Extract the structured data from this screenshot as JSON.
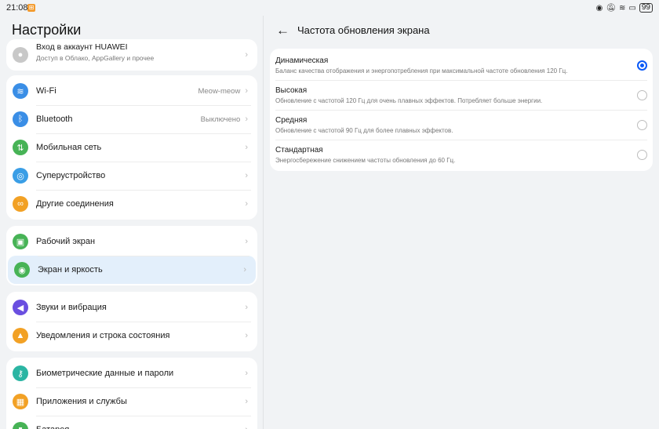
{
  "status_bar": {
    "time": "21:08",
    "battery": "99"
  },
  "left": {
    "title": "Настройки",
    "account": {
      "title": "Вход в аккаунт HUAWEI",
      "subtitle": "Доступ в Облако, AppGallery и прочее"
    },
    "groups": [
      [
        {
          "label": "Wi-Fi",
          "value": "Meow-meow",
          "icon": "wifi-icon",
          "color": "#3a8ee6"
        },
        {
          "label": "Bluetooth",
          "value": "Выключено",
          "icon": "bluetooth-icon",
          "color": "#3a8ee6"
        },
        {
          "label": "Мобильная сеть",
          "value": "",
          "icon": "mobile-network-icon",
          "color": "#47b356"
        },
        {
          "label": "Суперустройство",
          "value": "",
          "icon": "super-device-icon",
          "color": "#3a9ee6"
        },
        {
          "label": "Другие соединения",
          "value": "",
          "icon": "link-icon",
          "color": "#f2a125"
        }
      ],
      [
        {
          "label": "Рабочий экран",
          "value": "",
          "icon": "home-screen-icon",
          "color": "#47b356"
        },
        {
          "label": "Экран и яркость",
          "value": "",
          "icon": "eye-icon",
          "color": "#47b356",
          "active": true
        }
      ],
      [
        {
          "label": "Звуки и вибрация",
          "value": "",
          "icon": "speaker-icon",
          "color": "#6a4fe0"
        },
        {
          "label": "Уведомления и строка состояния",
          "value": "",
          "icon": "bell-icon",
          "color": "#f2a125"
        }
      ],
      [
        {
          "label": "Биометрические данные и пароли",
          "value": "",
          "icon": "key-icon",
          "color": "#2bb5a3"
        },
        {
          "label": "Приложения и службы",
          "value": "",
          "icon": "apps-icon",
          "color": "#f2a125"
        },
        {
          "label": "Батарея",
          "value": "",
          "icon": "battery-icon",
          "color": "#47b356"
        }
      ]
    ]
  },
  "right": {
    "title": "Частота обновления экрана",
    "options": [
      {
        "title": "Динамическая",
        "desc": "Баланс качества отображения и энергопотребления при максимальной частоте обновления 120 Гц.",
        "selected": true
      },
      {
        "title": "Высокая",
        "desc": "Обновление с частотой 120 Гц для очень плавных эффектов. Потребляет больше энергии.",
        "selected": false
      },
      {
        "title": "Средняя",
        "desc": "Обновление с частотой 90 Гц для более плавных эффектов.",
        "selected": false
      },
      {
        "title": "Стандартная",
        "desc": "Энергосбережение снижением частоты обновления до 60 Гц.",
        "selected": false
      }
    ],
    "accent": "#0a59f7"
  }
}
